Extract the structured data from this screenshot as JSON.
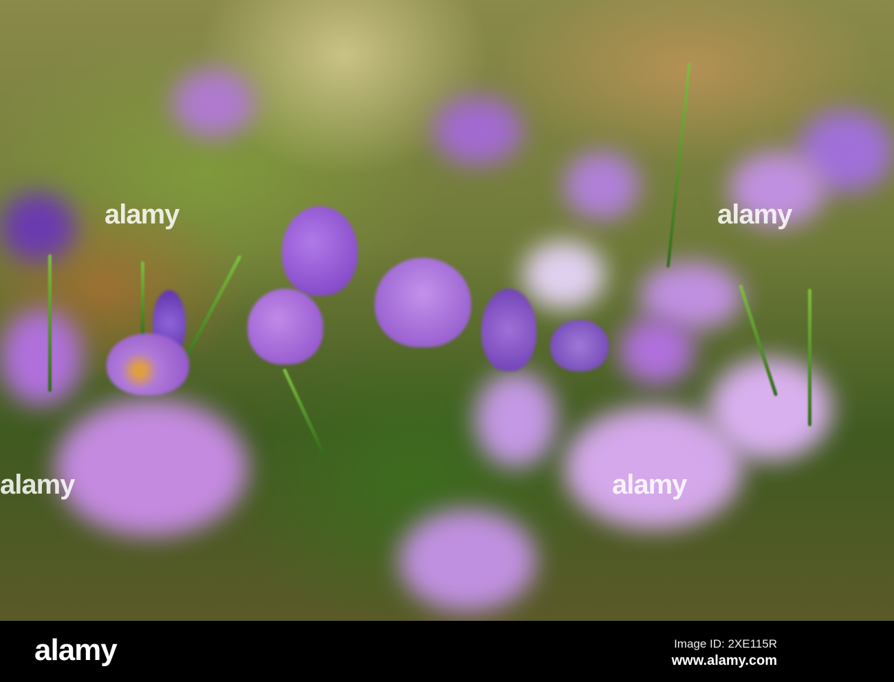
{
  "watermark": {
    "text": "alamy"
  },
  "footer": {
    "logo": "alamy",
    "image_id": "Image ID: 2XE115R",
    "site": "www.alamy.com"
  },
  "colors": {
    "crocus": "#9a5cd0",
    "grass": "#5a8a2a",
    "bar": "#000000"
  }
}
